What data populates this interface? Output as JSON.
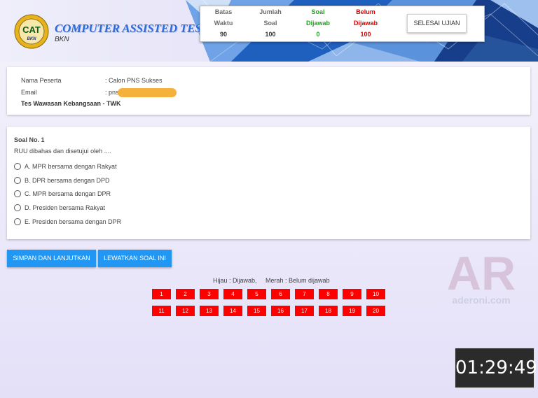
{
  "header": {
    "logo_text": "CAT",
    "logo_sub": "BKN",
    "title": "COMPUTER ASSISTED TEST",
    "subtitle": "BKN"
  },
  "stats": [
    {
      "line1": "Batas",
      "line2": "Waktu",
      "value": "90",
      "color": "gray"
    },
    {
      "line1": "Jumlah",
      "line2": "Soal",
      "value": "100",
      "color": "gray"
    },
    {
      "line1": "Soal",
      "line2": "Dijawab",
      "value": "0",
      "color": "green"
    },
    {
      "line1": "Belum",
      "line2": "Dijawab",
      "value": "100",
      "color": "red"
    }
  ],
  "finish_button": "SELESAI UJIAN",
  "participant": {
    "name_label": "Nama Peserta",
    "name_value": ": Calon PNS Sukses",
    "email_label": "Email",
    "email_value": ": pns",
    "subject": "Tes Wawasan Kebangsaan - TWK"
  },
  "question": {
    "number": "Soal No. 1",
    "text": "RUU dibahas dan disetujui oleh ....",
    "options": [
      "A. MPR bersama dengan Rakyat",
      "B. DPR bersama dengan DPD",
      "C. MPR bersama dengan DPR",
      "D. Presiden bersama Rakyat",
      "E. Presiden bersama dengan DPR"
    ]
  },
  "actions": {
    "save": "SIMPAN DAN LANJUTKAN",
    "skip": "LEWATKAN SOAL INI"
  },
  "legend": "Hijau : Dijawab,     Merah : Belum dijawab",
  "question_numbers": [
    "1",
    "2",
    "3",
    "4",
    "5",
    "6",
    "7",
    "8",
    "9",
    "10",
    "11",
    "12",
    "13",
    "14",
    "15",
    "16",
    "17",
    "18",
    "19",
    "20"
  ],
  "watermark": {
    "logo": "AR",
    "text": "aderoni.com"
  },
  "timer": "01:29:49",
  "colors": {
    "accent_blue": "#2196f3",
    "unanswered_red": "#ff0000",
    "answered_green": "#1fa31f",
    "email_mask": "#f4b23c",
    "timer_bg": "#2b2b2b"
  }
}
